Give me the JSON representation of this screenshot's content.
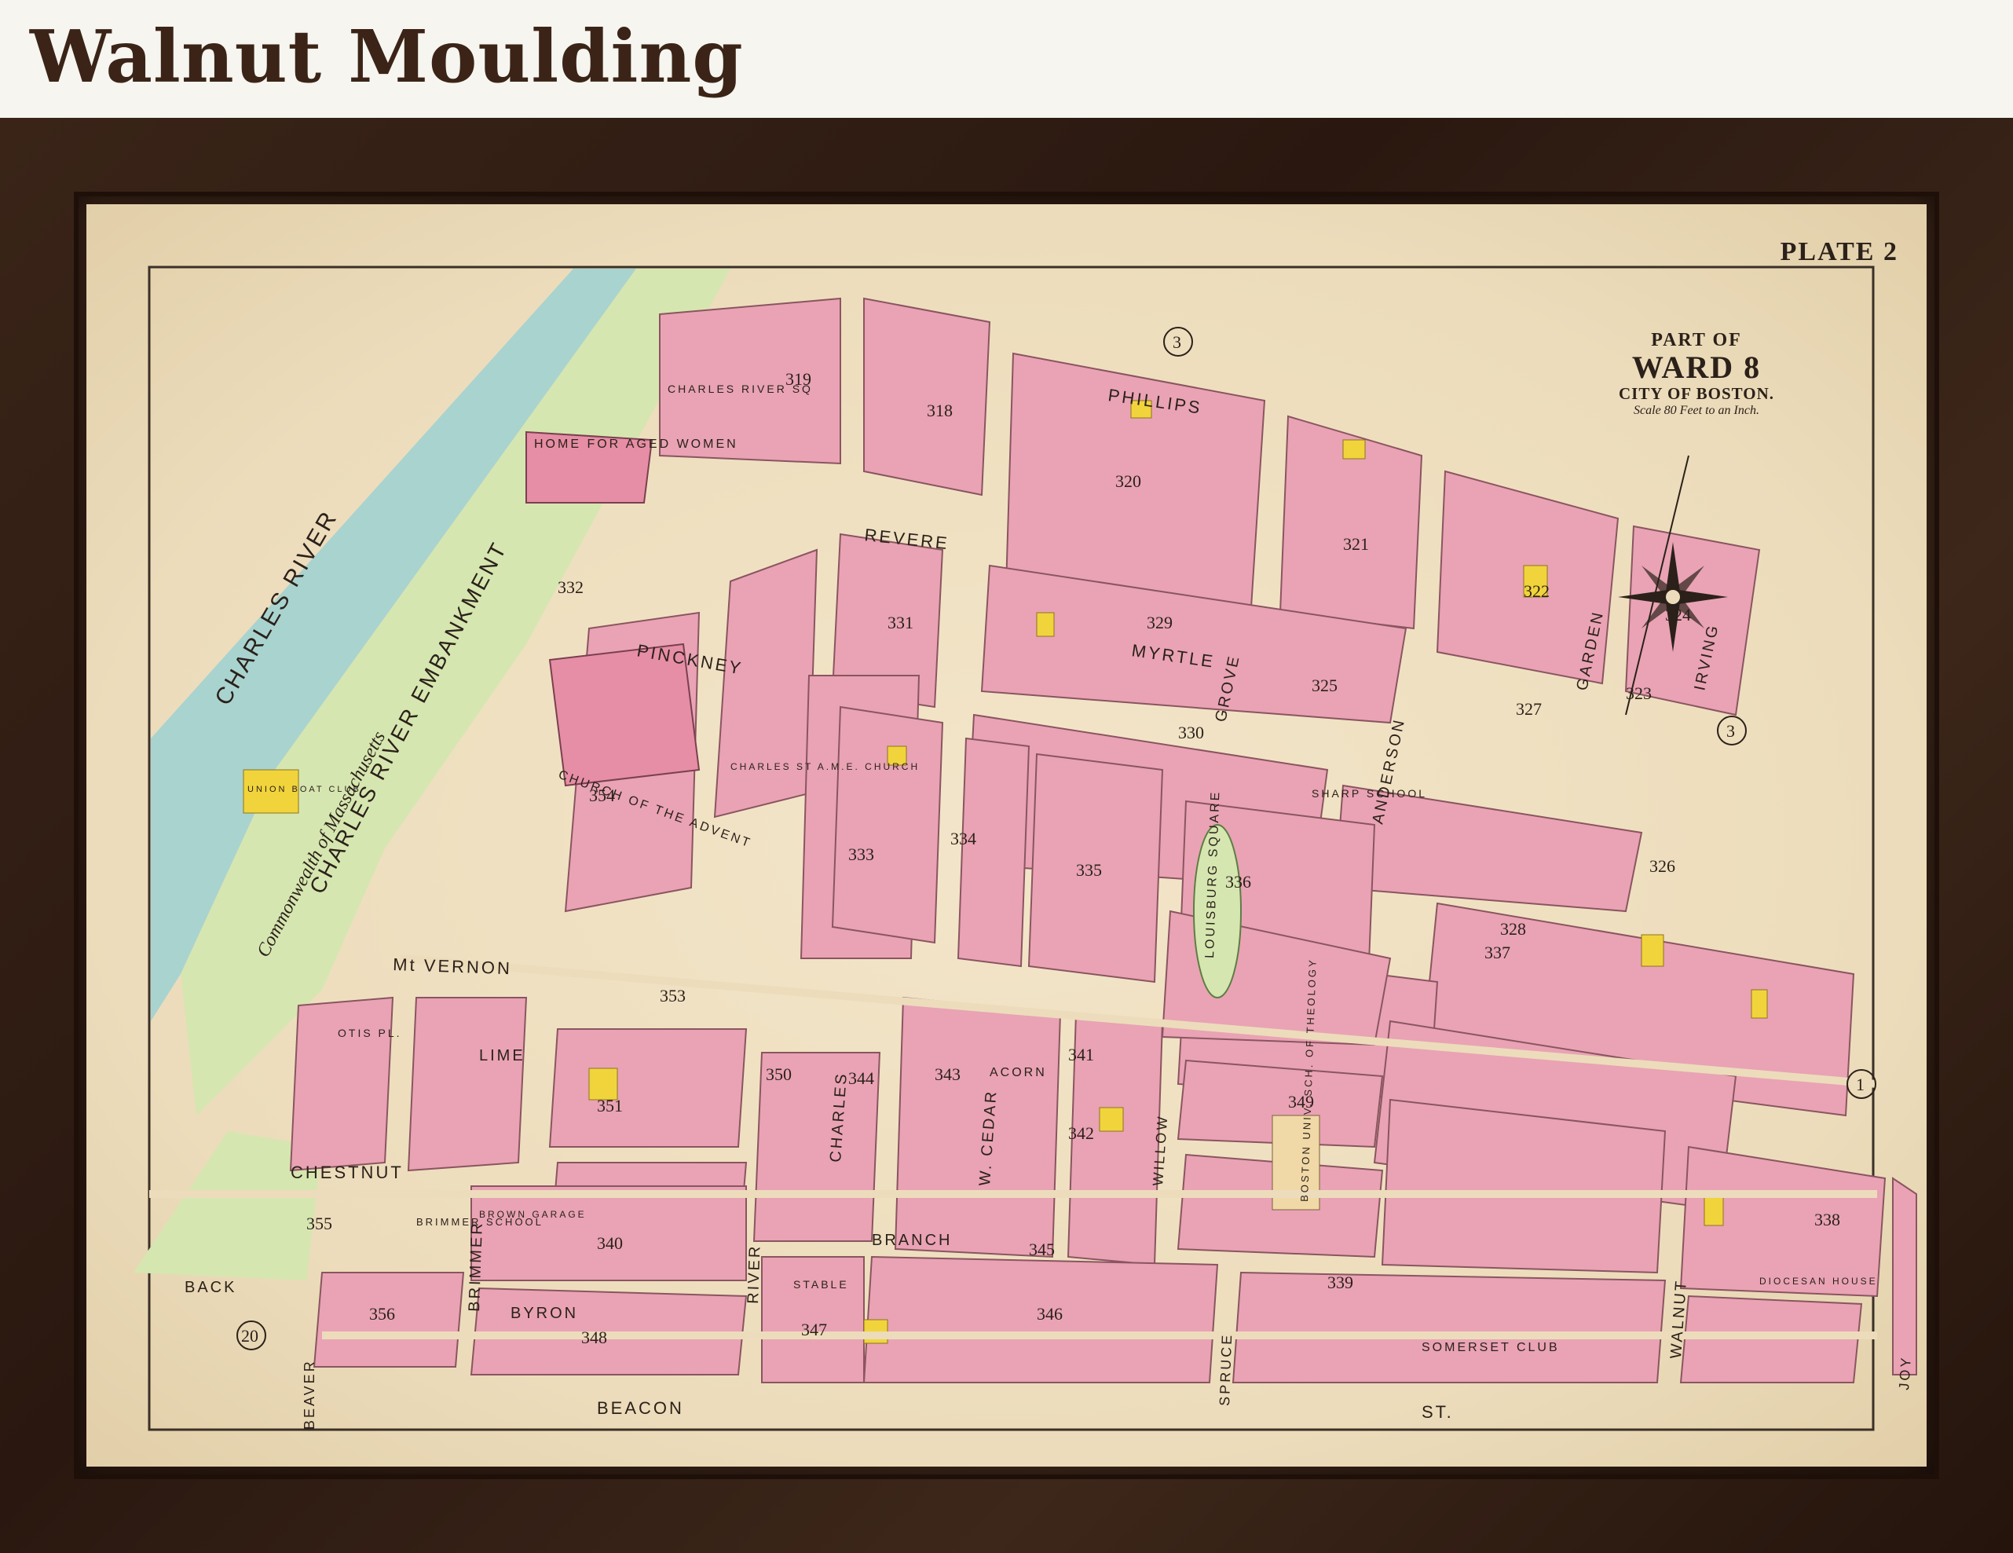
{
  "caption": "Walnut Moulding",
  "plate": "PLATE 2",
  "title": {
    "part_of": "PART OF",
    "ward": "WARD 8",
    "city": "CITY OF BOSTON.",
    "scale": "Scale 80 Feet to an Inch."
  },
  "water": {
    "river": "CHARLES RIVER",
    "embankment": "CHARLES RIVER EMBANKMENT",
    "commonwealth": "Commonwealth of Massachusetts"
  },
  "streets": {
    "phillips": "PHILLIPS",
    "revere": "REVERE",
    "pinckney": "PINCKNEY",
    "myrtle": "MYRTLE",
    "grove": "GROVE",
    "anderson": "ANDERSON",
    "garden": "GARDEN",
    "irving": "IRVING",
    "mt_vernon": "Mt VERNON",
    "lime": "LIME",
    "acorn": "ACORN",
    "chestnut": "CHESTNUT",
    "back": "BACK",
    "byron": "BYRON",
    "beaver": "BEAVER",
    "brimmer": "BRIMMER",
    "river": "RIVER",
    "charles": "CHARLES",
    "w_cedar": "W. CEDAR",
    "willow": "WILLOW",
    "branch": "BRANCH",
    "spruce": "SPRUCE",
    "walnut": "WALNUT",
    "joy": "JOY",
    "beacon": "BEACON",
    "st": "ST.",
    "otis_pl": "OTIS PL.",
    "louisburg_square": "LOUISBURG SQUARE",
    "charles_river_sq": "CHARLES RIVER SQ"
  },
  "buildings": {
    "home_aged_women": "HOME FOR AGED WOMEN",
    "union_boat_club": "UNION BOAT CLUB",
    "church_advent": "CHURCH OF THE ADVENT",
    "charles_st_church": "CHARLES ST A.M.E. CHURCH",
    "sharp_school": "SHARP SCHOOL",
    "boston_univ": "BOSTON UNIV. SCH. OF THEOLOGY",
    "brimmer_school": "BRIMMER SCHOOL",
    "somerset_club": "SOMERSET CLUB",
    "brown_garage": "BROWN GARAGE",
    "stable": "STABLE",
    "diocesan_house": "DIOCESAN HOUSE"
  },
  "ward_numbers": [
    "3",
    "3",
    "1",
    "20"
  ],
  "block_numbers": [
    "319",
    "318",
    "320",
    "321",
    "322",
    "323",
    "324",
    "325",
    "326",
    "327",
    "328",
    "329",
    "330",
    "331",
    "332",
    "333",
    "334",
    "335",
    "336",
    "337",
    "338",
    "339",
    "340",
    "341",
    "342",
    "343",
    "344",
    "345",
    "346",
    "347",
    "348",
    "349",
    "350",
    "351",
    "353",
    "354",
    "355",
    "356"
  ],
  "colors": {
    "paper": "#ecdcbb",
    "brick": "#e9a3b4",
    "wood": "#f2d9a0",
    "park": "#d6e6b0",
    "water": "#a9d3cf",
    "frame": "#2e1b10",
    "yellow": "#f1d43c"
  }
}
